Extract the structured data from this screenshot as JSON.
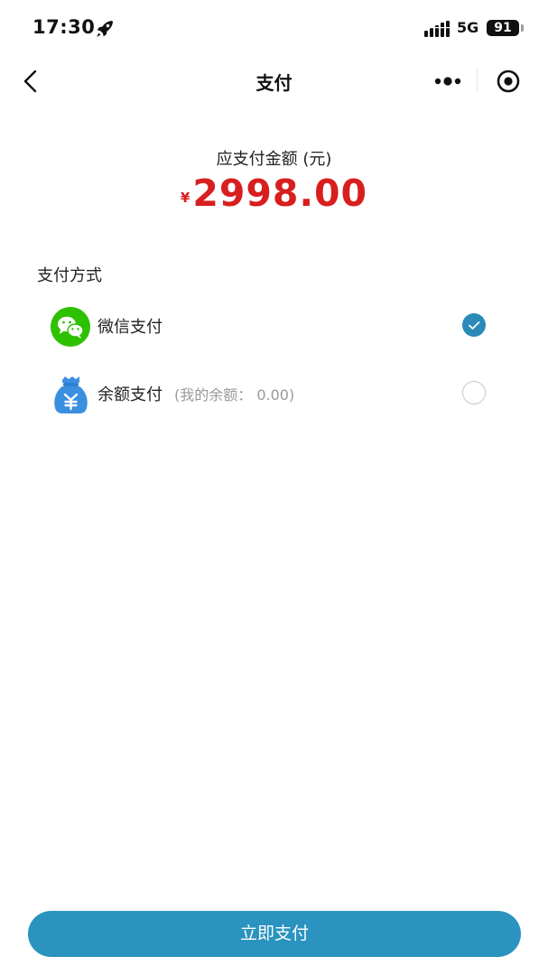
{
  "status_bar": {
    "time": "17:30",
    "network": "5G",
    "battery": "91"
  },
  "nav": {
    "title": "支付"
  },
  "payment": {
    "amount_label": "应支付金额 (元)",
    "currency_symbol": "¥",
    "amount": "2998.00"
  },
  "methods": {
    "section_title": "支付方式",
    "options": [
      {
        "label": "微信支付",
        "note": "",
        "selected": true,
        "icon": "wechat-icon"
      },
      {
        "label": "余额支付",
        "note": "(我的余额： 0.00)",
        "selected": false,
        "icon": "money-bag-icon"
      }
    ]
  },
  "actions": {
    "pay_now": "立即支付"
  },
  "colors": {
    "accent": "#2a93bf",
    "price": "#d81e1e",
    "wechat": "#2dc100",
    "balance_icon": "#3b8fe0"
  }
}
